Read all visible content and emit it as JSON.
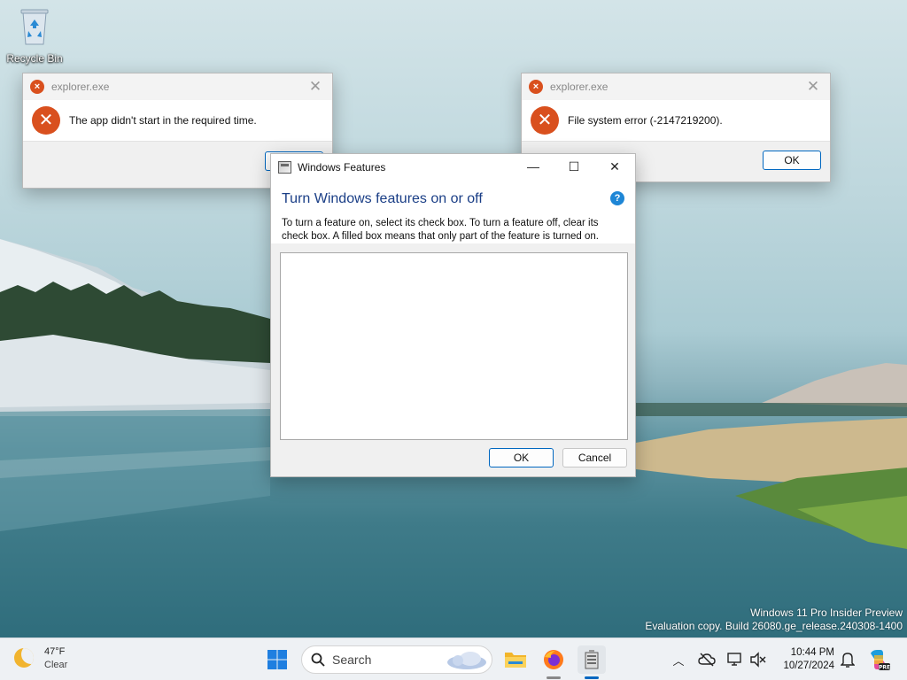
{
  "desktop": {
    "icons": [
      {
        "label": "Recycle Bin",
        "icon": "recycle-bin-icon"
      }
    ],
    "watermark": {
      "line1": "Windows 11 Pro Insider Preview",
      "line2": "Evaluation copy. Build 26080.ge_release.240308-1400"
    }
  },
  "error_dialog_left": {
    "title": "explorer.exe",
    "message": "The app didn't start in the required time.",
    "button": "OK"
  },
  "error_dialog_right": {
    "title": "explorer.exe",
    "message": "File system error (-2147219200).",
    "button": "OK"
  },
  "windows_features": {
    "title": "Windows Features",
    "heading": "Turn Windows features on or off",
    "description": "To turn a feature on, select its check box. To turn a feature off, clear its check box. A filled box means that only part of the feature is turned on.",
    "ok_label": "OK",
    "cancel_label": "Cancel",
    "help_glyph": "?"
  },
  "taskbar": {
    "weather": {
      "temp": "47°F",
      "condition": "Clear"
    },
    "search_placeholder": "Search",
    "clock": {
      "time": "10:44 PM",
      "date": "10/27/2024"
    }
  },
  "colors": {
    "error_red": "#d9501e",
    "accent_blue": "#0067c0",
    "heading_blue": "#1a3e86"
  }
}
